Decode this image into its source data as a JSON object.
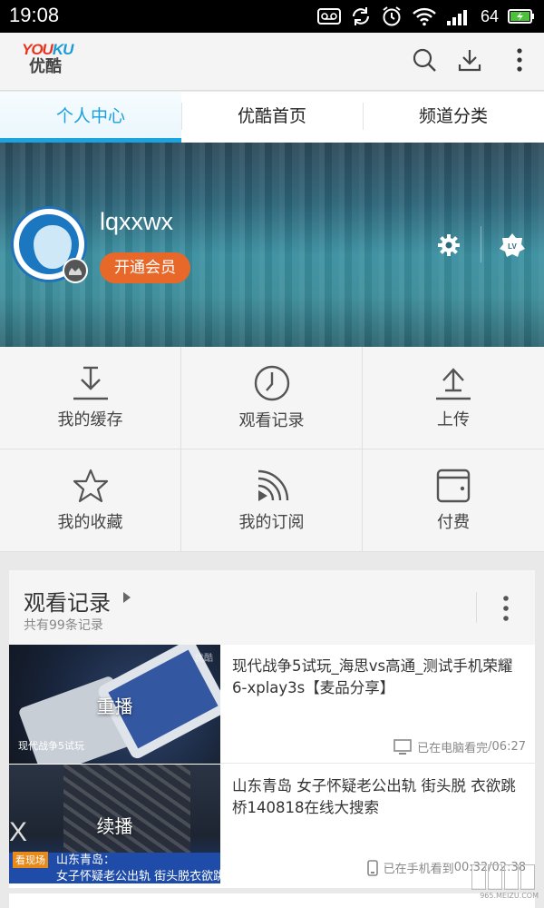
{
  "status_bar": {
    "time": "19:08",
    "battery_level": "64"
  },
  "app_bar": {
    "logo_en_1": "YOU",
    "logo_en_2": "KU",
    "logo_cn": "优酷"
  },
  "tabs": [
    {
      "label": "个人中心",
      "active": true
    },
    {
      "label": "优酷首页",
      "active": false
    },
    {
      "label": "频道分类",
      "active": false
    }
  ],
  "profile": {
    "username": "lqxxwx",
    "vip_button": "开通会员",
    "level_badge": "LV"
  },
  "grid": [
    {
      "label": "我的缓存",
      "icon": "download-tray-icon"
    },
    {
      "label": "观看记录",
      "icon": "clock-icon"
    },
    {
      "label": "上传",
      "icon": "upload-tray-icon"
    },
    {
      "label": "我的收藏",
      "icon": "star-icon"
    },
    {
      "label": "我的订阅",
      "icon": "rss-icon"
    },
    {
      "label": "付费",
      "icon": "wallet-icon"
    }
  ],
  "history": {
    "title": "观看记录",
    "subtitle": "共有99条记录",
    "items": [
      {
        "title": "现代战争5试玩_海思vs高通_测试手机荣耀6-xplay3s【麦品分享】",
        "overlay": "重播",
        "thumb_caption": "现代战争5试玩",
        "thumb_brand": "优酷",
        "device": "电脑",
        "status": "已在电脑看完",
        "duration": " /06:27"
      },
      {
        "title": "山东青岛 女子怀疑老公出轨 街头脱 衣欲跳桥140818在线大搜索",
        "overlay": "续播",
        "thumb_tag": "看现场",
        "thumb_caption_1": "山东青岛：",
        "thumb_caption_2": "女子怀疑老公出轨 街头脱衣欲跳桥",
        "device": "手机",
        "status": "已在手机看到",
        "duration": " 00:32/02:38"
      }
    ]
  },
  "watermark": "965.MEIZU.COM",
  "colors": {
    "accent": "#1ba4e0",
    "vip": "#e8682a",
    "status_bar": "#000000"
  }
}
